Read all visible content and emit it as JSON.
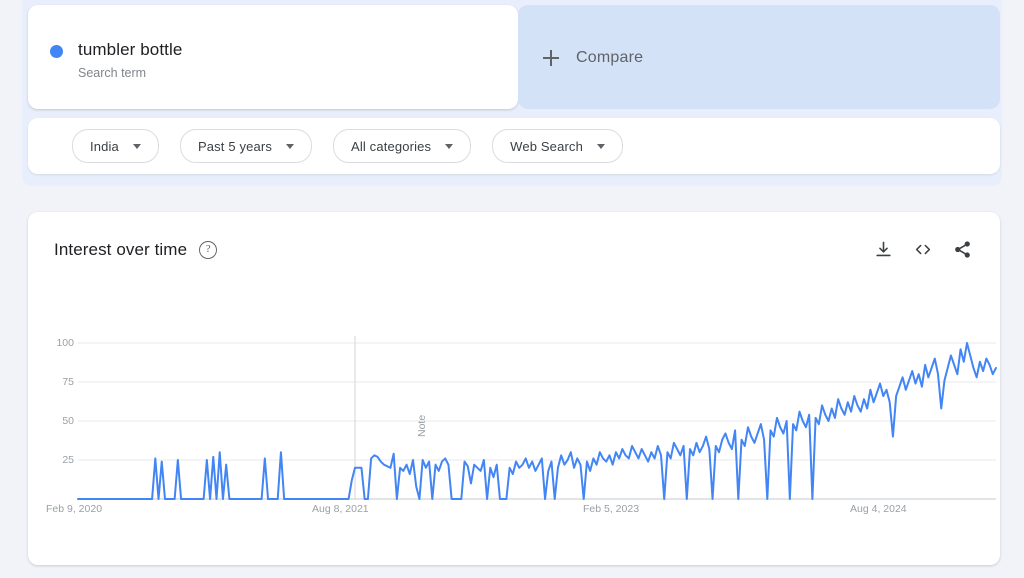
{
  "search_term": {
    "title": "tumbler bottle",
    "subtitle": "Search term",
    "dot_color": "#4285f4"
  },
  "compare": {
    "label": "Compare",
    "plus_icon": "plus-icon",
    "background": "#d4e2f7"
  },
  "filters": [
    {
      "label": "India",
      "icon": "chevron-down-icon"
    },
    {
      "label": "Past 5 years",
      "icon": "chevron-down-icon"
    },
    {
      "label": "All categories",
      "icon": "chevron-down-icon"
    },
    {
      "label": "Web Search",
      "icon": "chevron-down-icon"
    }
  ],
  "chart_card": {
    "title": "Interest over time",
    "help_icon": "help-circle-icon",
    "help_glyph": "?",
    "actions": [
      {
        "name": "download-icon",
        "tooltip": "Download"
      },
      {
        "name": "embed-code-icon",
        "tooltip": "Embed"
      },
      {
        "name": "share-icon",
        "tooltip": "Share"
      }
    ]
  },
  "chart_data": {
    "type": "line",
    "title": "Interest over time",
    "xlabel": "",
    "ylabel": "",
    "ylim": [
      0,
      100
    ],
    "yticks": [
      25,
      50,
      75,
      100
    ],
    "grid": true,
    "legend": false,
    "line_color": "#4285f4",
    "xtick_labels": [
      "Feb 9, 2020",
      "Aug 8, 2021",
      "Feb 5, 2023",
      "Aug 4, 2024"
    ],
    "xtick_positions": [
      0,
      78,
      156,
      234
    ],
    "annotations": [
      {
        "label": "Note",
        "x_index": 86,
        "type": "vertical-line"
      }
    ],
    "series": [
      {
        "name": "tumbler bottle",
        "values": [
          0,
          0,
          0,
          0,
          0,
          0,
          0,
          0,
          0,
          0,
          0,
          0,
          0,
          0,
          0,
          0,
          0,
          0,
          0,
          0,
          0,
          0,
          0,
          0,
          26,
          0,
          24,
          0,
          0,
          0,
          0,
          25,
          0,
          0,
          0,
          0,
          0,
          0,
          0,
          0,
          25,
          0,
          27,
          0,
          30,
          0,
          22,
          0,
          0,
          0,
          0,
          0,
          0,
          0,
          0,
          0,
          0,
          0,
          26,
          0,
          0,
          0,
          0,
          30,
          0,
          0,
          0,
          0,
          0,
          0,
          0,
          0,
          0,
          0,
          0,
          0,
          0,
          0,
          0,
          0,
          0,
          0,
          0,
          0,
          0,
          12,
          20,
          20,
          20,
          0,
          0,
          26,
          28,
          27,
          24,
          22,
          21,
          20,
          29,
          0,
          20,
          18,
          22,
          16,
          25,
          8,
          0,
          25,
          20,
          24,
          0,
          22,
          18,
          24,
          26,
          22,
          0,
          0,
          0,
          0,
          24,
          21,
          10,
          22,
          20,
          18,
          25,
          0,
          20,
          14,
          22,
          0,
          0,
          0,
          20,
          16,
          24,
          20,
          22,
          26,
          20,
          24,
          18,
          22,
          26,
          0,
          18,
          24,
          0,
          20,
          28,
          22,
          25,
          30,
          20,
          26,
          22,
          0,
          24,
          18,
          26,
          22,
          30,
          26,
          24,
          28,
          22,
          30,
          26,
          32,
          28,
          26,
          34,
          30,
          26,
          32,
          28,
          24,
          30,
          26,
          34,
          28,
          0,
          30,
          26,
          36,
          32,
          28,
          34,
          0,
          32,
          28,
          36,
          30,
          34,
          40,
          32,
          0,
          34,
          30,
          38,
          42,
          36,
          32,
          44,
          0,
          38,
          34,
          46,
          40,
          36,
          42,
          48,
          38,
          0,
          44,
          40,
          52,
          46,
          42,
          50,
          0,
          48,
          44,
          56,
          50,
          46,
          54,
          0,
          52,
          48,
          60,
          54,
          50,
          58,
          52,
          64,
          58,
          54,
          62,
          56,
          66,
          60,
          56,
          64,
          58,
          70,
          62,
          68,
          74,
          66,
          70,
          62,
          40,
          66,
          72,
          78,
          70,
          76,
          82,
          74,
          80,
          72,
          86,
          78,
          84,
          90,
          80,
          58,
          76,
          84,
          92,
          86,
          80,
          96,
          88,
          100,
          92,
          84,
          78,
          88,
          82,
          90,
          86,
          80,
          84
        ]
      }
    ]
  }
}
